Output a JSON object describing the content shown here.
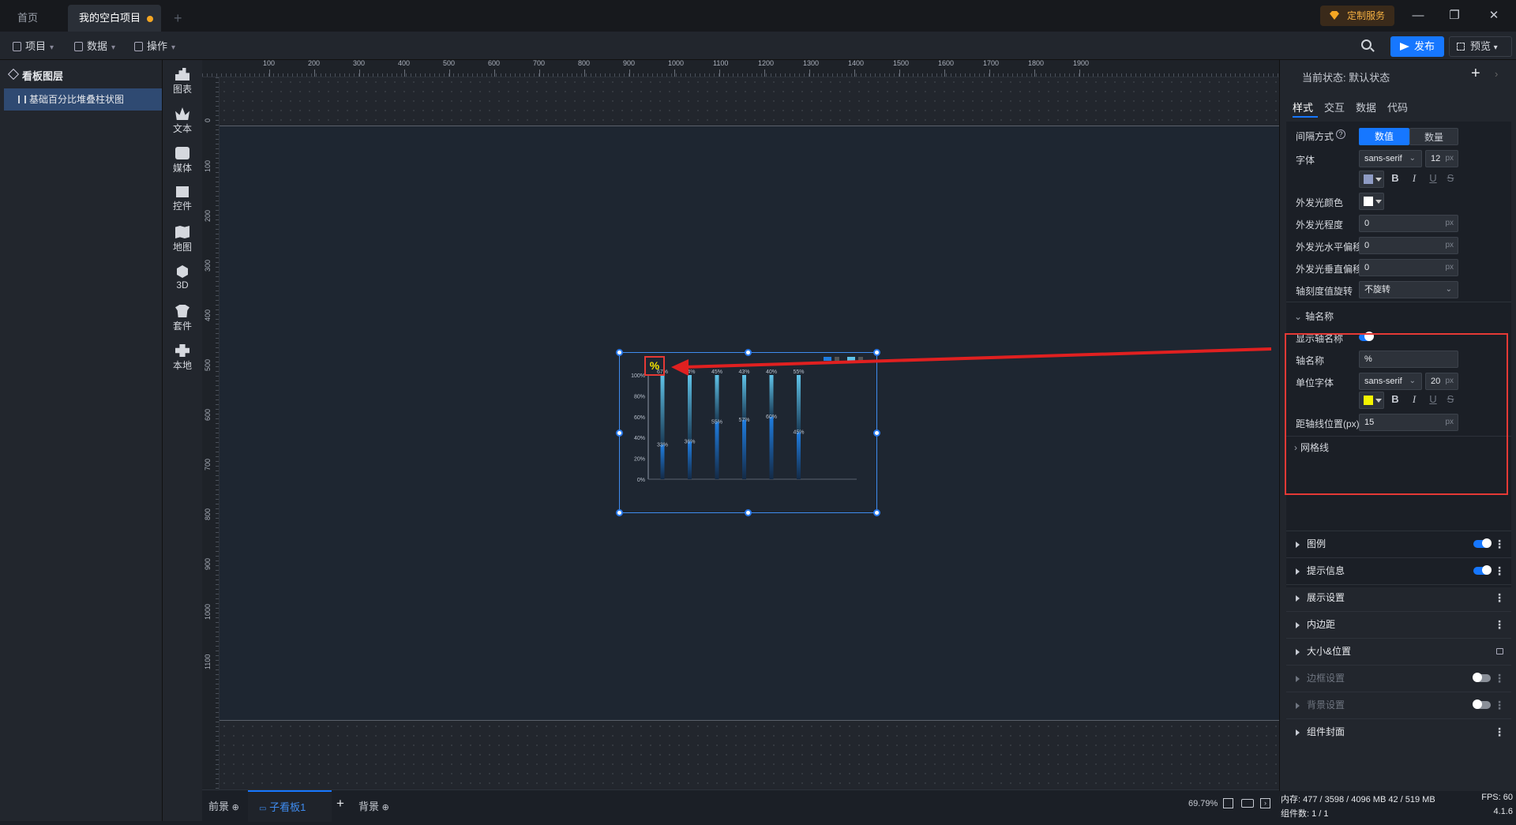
{
  "tabs": {
    "home": "首页",
    "project": "我的空白项目"
  },
  "vip_label": "定制服务",
  "toolbar": {
    "project": "项目",
    "data": "数据",
    "operate": "操作",
    "publish": "发布",
    "preview": "预览"
  },
  "layers": {
    "title": "看板图层",
    "items": [
      "基础百分比堆叠柱状图"
    ]
  },
  "components": [
    "图表",
    "文本",
    "媒体",
    "控件",
    "地图",
    "3D",
    "套件",
    "本地"
  ],
  "ruler_top": [
    "100",
    "200",
    "300",
    "400",
    "500",
    "600",
    "700",
    "800",
    "900",
    "1000",
    "1100",
    "1200",
    "1300",
    "1400",
    "1500",
    "1600",
    "1700",
    "1800",
    "1900"
  ],
  "ruler_left": [
    "0",
    "100",
    "200",
    "300",
    "400",
    "500",
    "600",
    "700",
    "800",
    "900",
    "1000",
    "1100"
  ],
  "chart_data": {
    "type": "bar",
    "stacked": true,
    "axis_name": "%",
    "ytick_labels": [
      "100%",
      "80%",
      "60%",
      "40%",
      "20%",
      "0%"
    ],
    "series": [
      {
        "values": [
          33,
          36,
          55,
          57,
          60,
          45
        ],
        "labels": [
          "33%",
          "36%",
          "55%",
          "57%",
          "60%",
          "45%"
        ]
      },
      {
        "values": [
          67,
          64,
          45,
          43,
          40,
          55
        ],
        "labels": [
          "67%",
          "64%",
          "45%",
          "43%",
          "40%",
          "55%"
        ]
      }
    ],
    "ylim": [
      0,
      100
    ]
  },
  "props": {
    "state_label": "当前状态:  默认状态",
    "tabs": [
      "样式",
      "交互",
      "数据",
      "代码"
    ],
    "interval_label": "间隔方式",
    "interval_options": [
      "数值",
      "数量"
    ],
    "font_label": "字体",
    "font_family": "sans-serif",
    "font_size": "12",
    "glow_color_label": "外发光颜色",
    "glow_level_label": "外发光程度",
    "glow_level": "0",
    "glow_h_label": "外发光水平偏移",
    "glow_h": "0",
    "glow_v_label": "外发光垂直偏移",
    "glow_v": "0",
    "tick_rotate_label": "轴刻度值旋转",
    "tick_rotate_value": "不旋转",
    "axis_name_section": "轴名称",
    "show_axis_name_label": "显示轴名称",
    "axis_name_label": "轴名称",
    "axis_name_value": "%",
    "unit_font_label": "单位字体",
    "unit_font_family": "sans-serif",
    "unit_font_size": "20",
    "axis_dist_label": "距轴线位置(px)",
    "axis_dist_value": "15",
    "grid_section": "网格线",
    "unit": "px",
    "fmt": {
      "b": "B",
      "i": "I",
      "u": "U",
      "s": "S"
    },
    "font_color": "#8e9bc4",
    "glow_color": "#ffffff",
    "unit_font_color": "#f5f500",
    "sections": [
      {
        "label": "图例",
        "toggle": "on"
      },
      {
        "label": "提示信息",
        "toggle": "on"
      },
      {
        "label": "展示设置"
      },
      {
        "label": "内边距"
      },
      {
        "label": "大小&位置",
        "lock": true
      },
      {
        "label": "边框设置",
        "toggle": "off",
        "dim": true
      },
      {
        "label": "背景设置",
        "toggle": "off",
        "dim": true
      },
      {
        "label": "组件封面"
      }
    ]
  },
  "bottom": {
    "front": "前景",
    "sub_board": "子看板1",
    "bg": "背景",
    "zoom": "69.79%"
  },
  "status": {
    "memory": "内存:  477 / 3598 / 4096 MB  42 / 519 MB",
    "fps": "FPS:  60",
    "components": "组件数: 1 / 1",
    "version": "4.1.6"
  }
}
